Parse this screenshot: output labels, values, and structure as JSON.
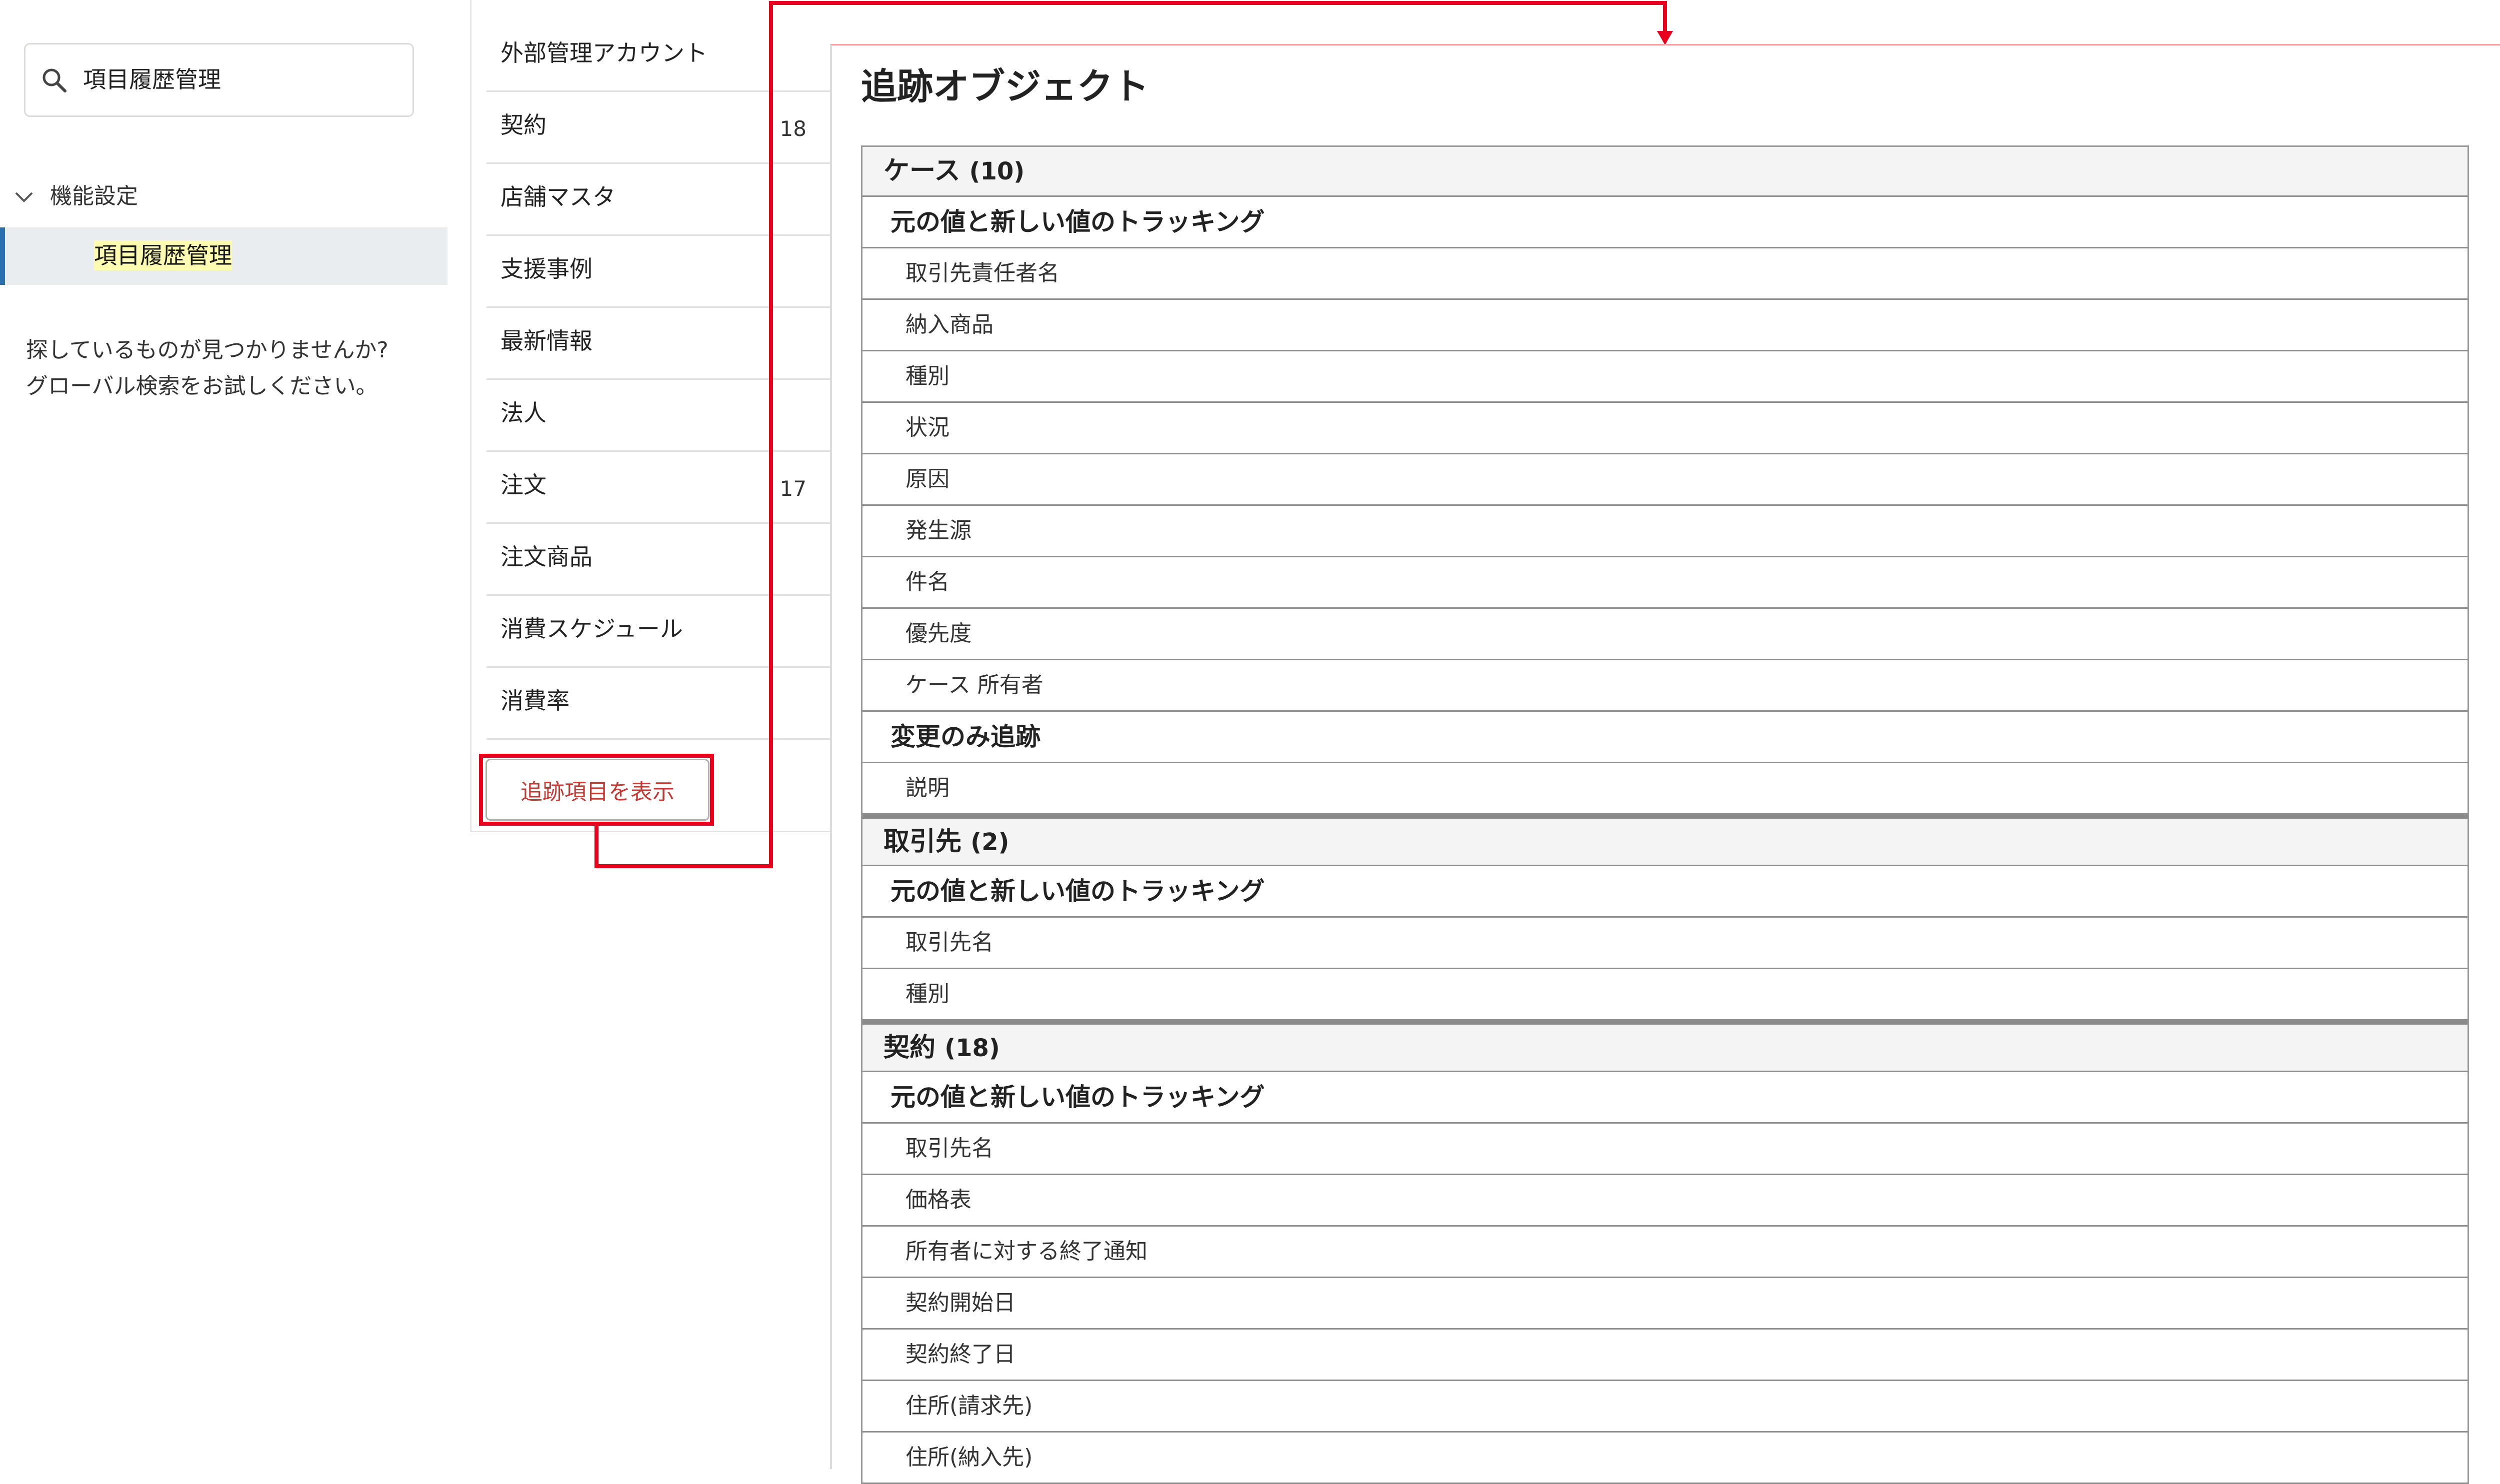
{
  "sidebar": {
    "search_value": "項目履歴管理",
    "tree_group": "機能設定",
    "tree_item": "項目履歴管理",
    "no_results": [
      "探しているものが見つかりませんか?",
      "グローバル検索をお試しください。"
    ]
  },
  "object_list": {
    "items": [
      {
        "name": "外部管理アカウント",
        "count": ""
      },
      {
        "name": "契約",
        "count": "18"
      },
      {
        "name": "店舗マスタ",
        "count": ""
      },
      {
        "name": "支援事例",
        "count": ""
      },
      {
        "name": "最新情報",
        "count": ""
      },
      {
        "name": "法人",
        "count": ""
      },
      {
        "name": "注文",
        "count": "17"
      },
      {
        "name": "注文商品",
        "count": ""
      },
      {
        "name": "消費スケジュール",
        "count": ""
      },
      {
        "name": "消費率",
        "count": ""
      }
    ],
    "button_label": "追跡項目を表示"
  },
  "annotation": {
    "color": "#e8001c"
  },
  "tracked": {
    "title": "追跡オブジェクト",
    "objects": [
      {
        "name": "ケース",
        "count": "(10)",
        "groups": [
          {
            "label": "元の値と新しい値のトラッキング",
            "fields": [
              "取引先責任者名",
              "納入商品",
              "種別",
              "状況",
              "原因",
              "発生源",
              "件名",
              "優先度",
              "ケース 所有者"
            ]
          },
          {
            "label": "変更のみ追跡",
            "fields": [
              "説明"
            ]
          }
        ]
      },
      {
        "name": "取引先",
        "count": "(2)",
        "groups": [
          {
            "label": "元の値と新しい値のトラッキング",
            "fields": [
              "取引先名",
              "種別"
            ]
          }
        ]
      },
      {
        "name": "契約",
        "count": "(18)",
        "groups": [
          {
            "label": "元の値と新しい値のトラッキング",
            "fields": [
              "取引先名",
              "価格表",
              "所有者に対する終了通知",
              "契約開始日",
              "契約終了日",
              "住所(請求先)",
              "住所(納入先)"
            ]
          }
        ]
      }
    ]
  }
}
